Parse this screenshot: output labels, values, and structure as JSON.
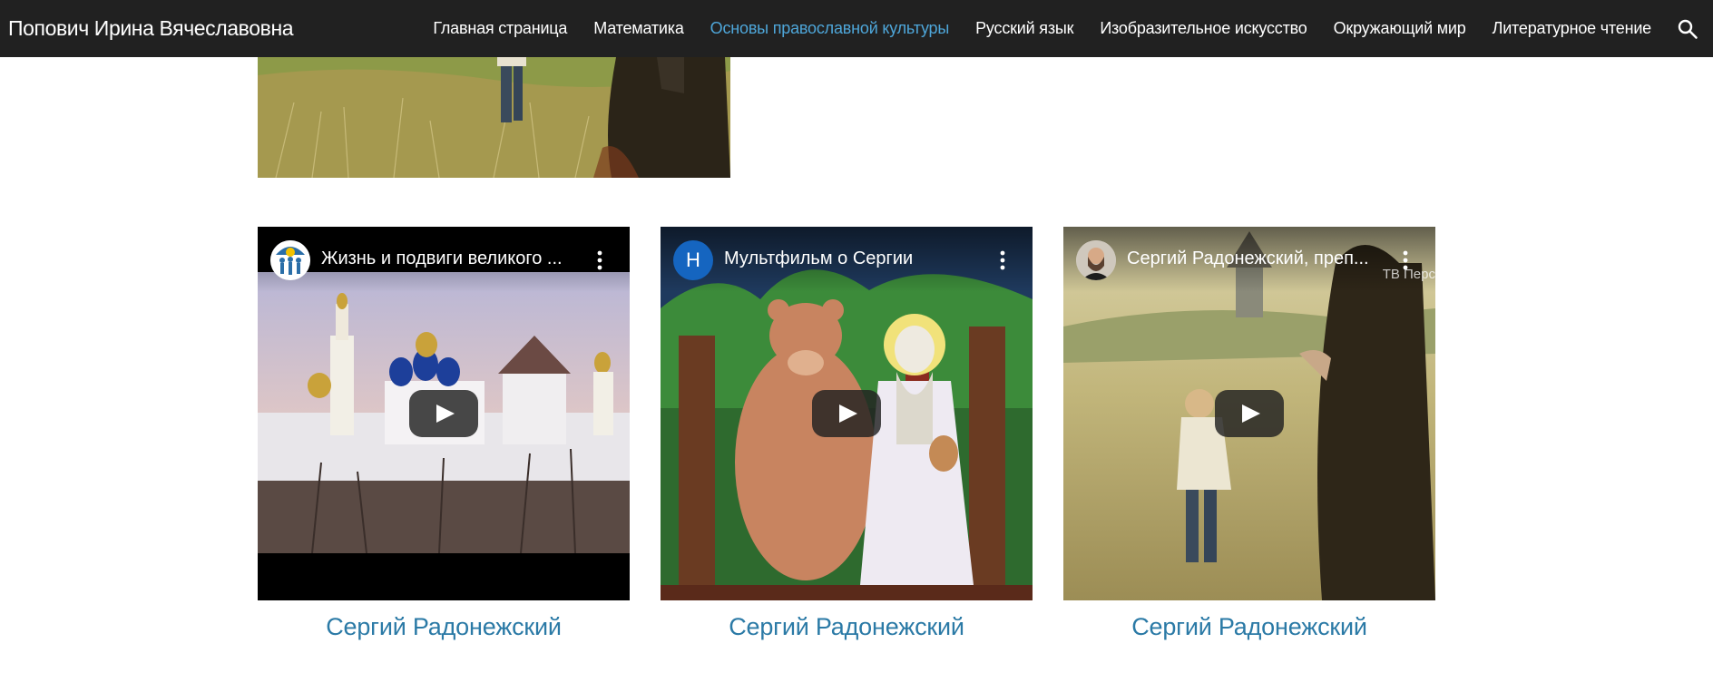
{
  "header": {
    "site_title": "Попович Ирина Вячеславовна",
    "nav": [
      {
        "label": "Главная страница",
        "active": false
      },
      {
        "label": "Математика",
        "active": false
      },
      {
        "label": "Основы православной культуры",
        "active": true
      },
      {
        "label": "Русский язык",
        "active": false
      },
      {
        "label": "Изобразительное искусство",
        "active": false
      },
      {
        "label": "Окружающий мир",
        "active": false
      },
      {
        "label": "Литературное чтение",
        "active": false
      }
    ],
    "search_icon": "search-icon"
  },
  "videos": [
    {
      "title": "Жизнь и подвиги великого ...",
      "avatar_icon": "channel-logo-icon",
      "caption": "Сергий Радонежский"
    },
    {
      "title": "Мультфильм о Сергии",
      "avatar_letter": "Н",
      "caption": "Сергий Радонежский"
    },
    {
      "title": "Сергий Радонежский, преп...",
      "watermark": "ТВ Перс",
      "avatar_icon": "channel-photo-icon",
      "caption": "Сергий Радонежский"
    }
  ],
  "colors": {
    "topbar": "#212121",
    "nav_active": "#4ea6d9",
    "caption_link": "#2b7aa6",
    "avatar_blue": "#1565c0"
  }
}
